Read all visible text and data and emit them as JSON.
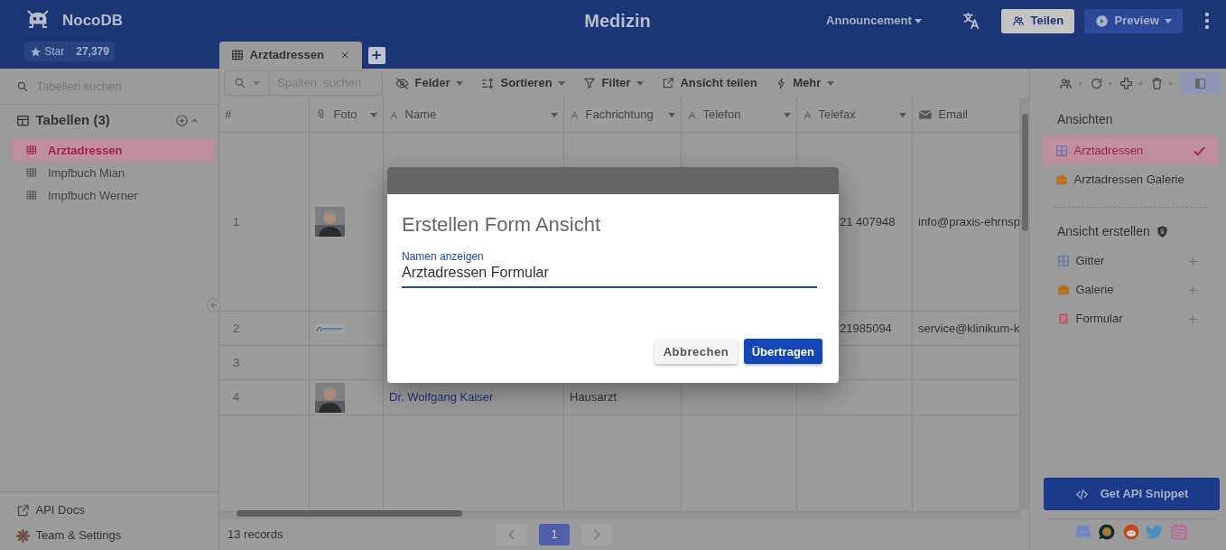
{
  "app": {
    "name": "NocoDB",
    "star_label": "Star",
    "star_count": "27,379"
  },
  "title": "Medizin",
  "header_actions": {
    "announcement": "Announcement",
    "share": "Teilen",
    "preview": "Preview"
  },
  "tabs": [
    {
      "label": "Arztadressen",
      "selected": true
    }
  ],
  "sidebar": {
    "search_placeholder": "Tabellen suchen",
    "heading": "Tabellen (3)",
    "items": [
      {
        "label": "Arztadressen",
        "selected": true
      },
      {
        "label": "Impfbuch Mian",
        "selected": false
      },
      {
        "label": "Impfbuch Werner",
        "selected": false
      }
    ],
    "footer": [
      {
        "label": "API Docs",
        "kind": "link"
      },
      {
        "label": "Team & Settings",
        "kind": "settings"
      }
    ]
  },
  "toolbar": {
    "search_placeholder": "Spalten  suchen",
    "buttons": [
      {
        "label": "Felder",
        "kind": "fields",
        "dropdown": true
      },
      {
        "label": "Sortieren",
        "kind": "sort",
        "dropdown": true
      },
      {
        "label": "Filter",
        "kind": "filter",
        "dropdown": true
      },
      {
        "label": "Ansicht teilen",
        "kind": "share",
        "dropdown": false
      },
      {
        "label": "Mehr",
        "kind": "more",
        "dropdown": true
      }
    ]
  },
  "table": {
    "columns": [
      {
        "label": "#",
        "kind": "index",
        "dropdown": false
      },
      {
        "label": "Foto",
        "kind": "attachment",
        "dropdown": true
      },
      {
        "label": "Name",
        "kind": "text",
        "dropdown": true
      },
      {
        "label": "Fachrichtung",
        "kind": "text",
        "dropdown": true
      },
      {
        "label": "Telefon",
        "kind": "text",
        "dropdown": true
      },
      {
        "label": "Telefax",
        "kind": "text",
        "dropdown": true
      },
      {
        "label": "Email",
        "kind": "email",
        "dropdown": false
      }
    ],
    "rows": [
      {
        "cells": [
          "1",
          {
            "kind": "portrait"
          },
          null,
          null,
          null,
          "21 407948",
          "info@praxis-ehrnsp"
        ]
      },
      {
        "cells": [
          "2",
          {
            "kind": "logo"
          },
          null,
          null,
          null,
          "21985094",
          "service@klinikum-k"
        ]
      },
      {
        "cells": [
          "3",
          null,
          null,
          null,
          null,
          null,
          null
        ]
      },
      {
        "cells": [
          "4",
          {
            "kind": "portrait"
          },
          "Dr. Wolfgang Kaiser",
          "Hausarzt",
          null,
          null,
          null
        ]
      }
    ]
  },
  "footer": {
    "records": "13 records",
    "pages": [
      {
        "label": "1",
        "selected": true
      }
    ]
  },
  "views": {
    "heading": "Ansichten",
    "items": [
      {
        "label": "Arztadressen",
        "kind": "grid",
        "selected": true
      },
      {
        "label": "Arztadressen Galerie",
        "kind": "gallery",
        "selected": false
      }
    ],
    "create_heading": "Ansicht erstellen",
    "create_items": [
      {
        "label": "Gitter",
        "kind": "grid"
      },
      {
        "label": "Galerie",
        "kind": "gallery"
      },
      {
        "label": "Formular",
        "kind": "form"
      }
    ],
    "api_button": "Get API Snippet"
  },
  "dialog": {
    "title": "Erstellen Form Ansicht",
    "field_label": "Namen anzeigen",
    "field_value": "Arztadressen Formular",
    "buttons": [
      {
        "label": "Abbrechen",
        "kind": "secondary"
      },
      {
        "label": "Übertragen",
        "kind": "primary"
      }
    ]
  }
}
